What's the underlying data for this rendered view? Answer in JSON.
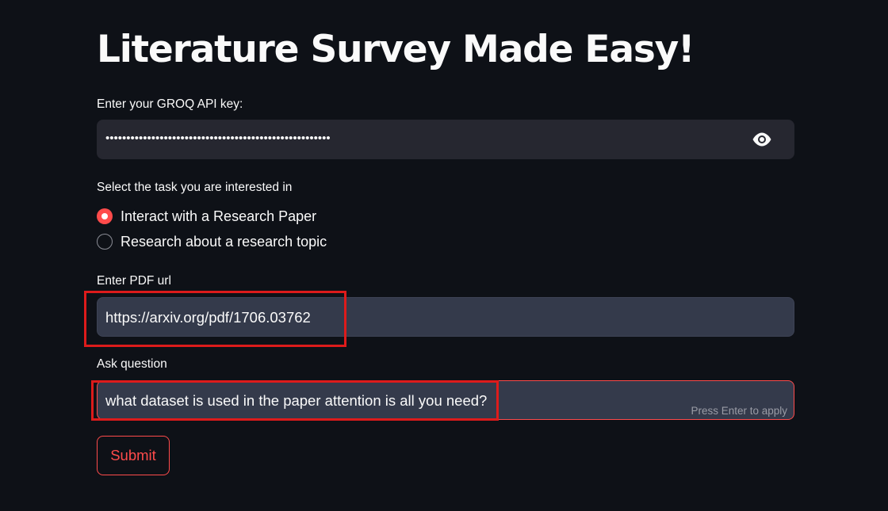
{
  "page": {
    "title": "Literature Survey Made Easy!"
  },
  "api_key": {
    "label": "Enter your GROQ API key:",
    "masked_value": "••••••••••••••••••••••••••••••••••••••••••••••••••••••"
  },
  "task": {
    "label": "Select the task you are interested in",
    "options": [
      {
        "label": "Interact with a Research Paper",
        "selected": true
      },
      {
        "label": "Research about a research topic",
        "selected": false
      }
    ]
  },
  "pdf_url": {
    "label": "Enter PDF url",
    "value": "https://arxiv.org/pdf/1706.03762"
  },
  "question": {
    "label": "Ask question",
    "value": "what dataset is used in the paper attention is all you need?",
    "hint": "Press Enter to apply"
  },
  "submit": {
    "label": "Submit"
  },
  "colors": {
    "background": "#0e1117",
    "accent": "#ff4b4b",
    "annotation": "#dd1b1b",
    "input_bg": "#262730",
    "input_active_bg": "#343a4b"
  },
  "icons": {
    "reveal_password": "eye-icon"
  }
}
